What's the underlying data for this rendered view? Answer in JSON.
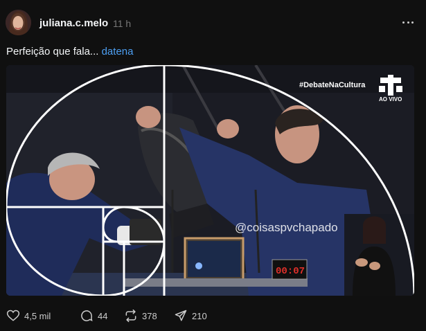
{
  "post": {
    "username": "juliana.c.melo",
    "time": "11 h",
    "caption_text": "Perfeição que fala... ",
    "caption_tag": "datena"
  },
  "media": {
    "hashtag_overlay": "#DebateNaCultura",
    "live_label": "AO VIVO",
    "watermark": "@coisaspvchapado",
    "timer": "00:07"
  },
  "actions": {
    "likes": "4,5 mil",
    "comments": "44",
    "reposts": "378",
    "shares": "210"
  },
  "icons": {
    "more": "more-horizontal-icon",
    "like": "heart-icon",
    "comment": "comment-bubble-icon",
    "repost": "repost-icon",
    "share": "send-icon"
  },
  "colors": {
    "background": "#101010",
    "link": "#4d9ff2",
    "timer_red": "#e0302a"
  }
}
